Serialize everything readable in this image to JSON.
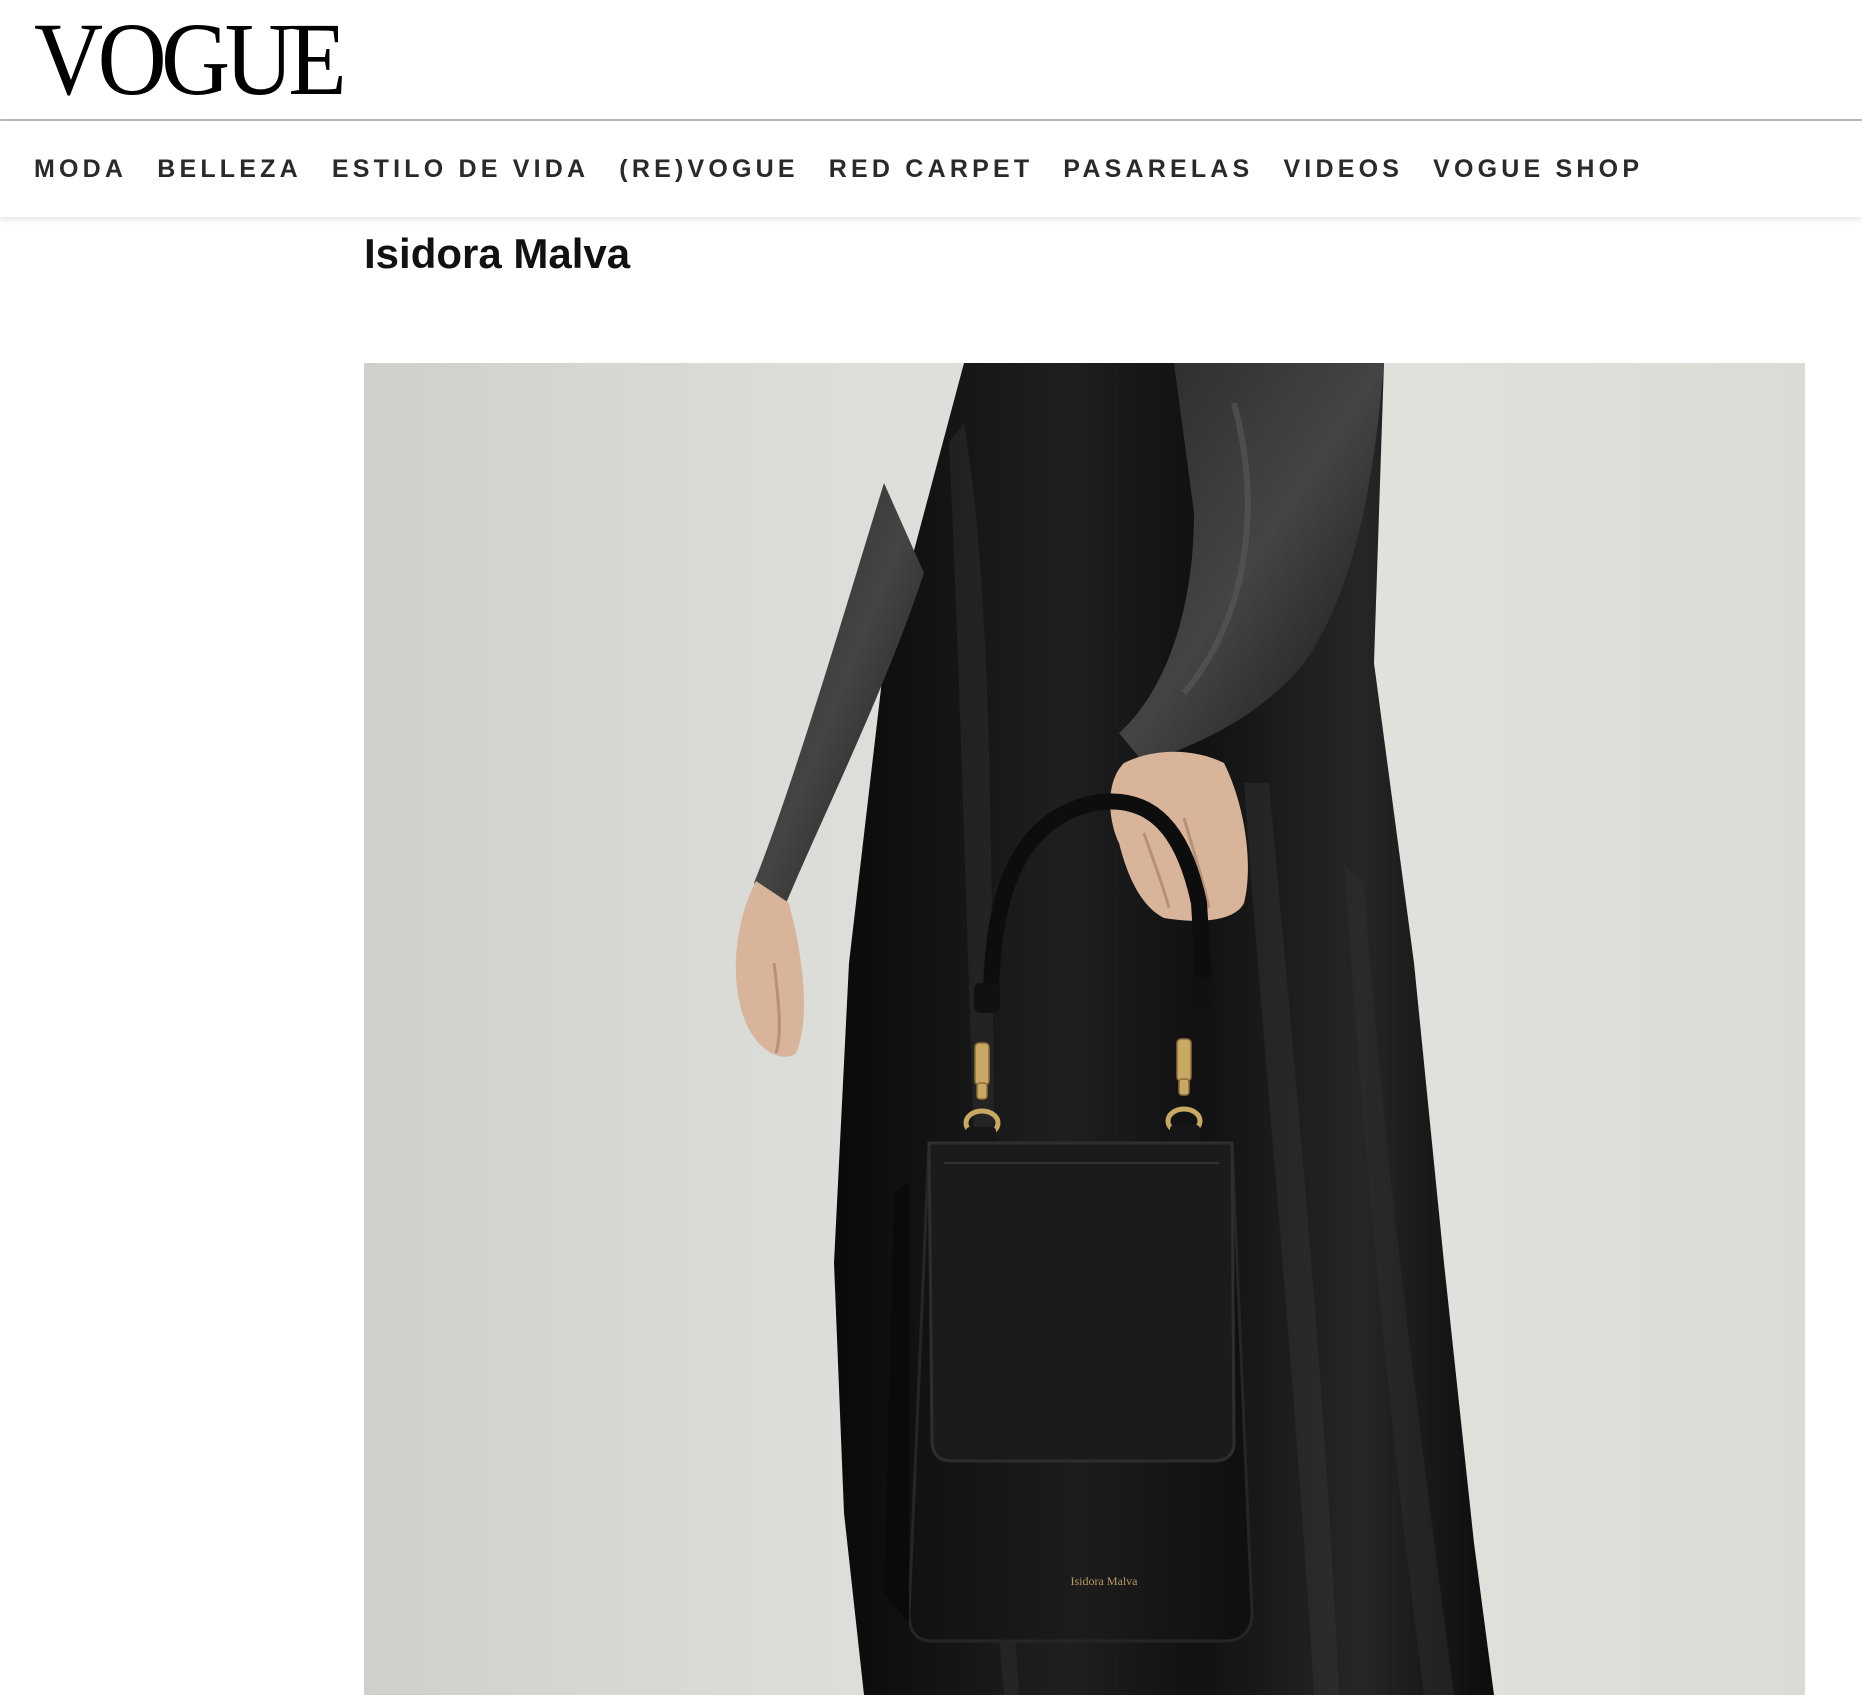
{
  "site": {
    "logo_text": "VOGUE"
  },
  "nav": {
    "items": [
      {
        "label": "MODA"
      },
      {
        "label": "BELLEZA"
      },
      {
        "label": "ESTILO DE VIDA"
      },
      {
        "label": "(RE)VOGUE"
      },
      {
        "label": "RED CARPET"
      },
      {
        "label": "PASARELAS"
      },
      {
        "label": "VIDEOS"
      },
      {
        "label": "VOGUE SHOP"
      }
    ]
  },
  "article": {
    "title": "Isidora Malva",
    "image": {
      "subject": "model in black velvet dress holding black leather handbag",
      "bag_stamp": "Isidora Malva"
    }
  },
  "colors": {
    "nav_text": "#2a2a2a",
    "divider": "#b8b8b8",
    "photo_background": "#dcdcd8"
  }
}
